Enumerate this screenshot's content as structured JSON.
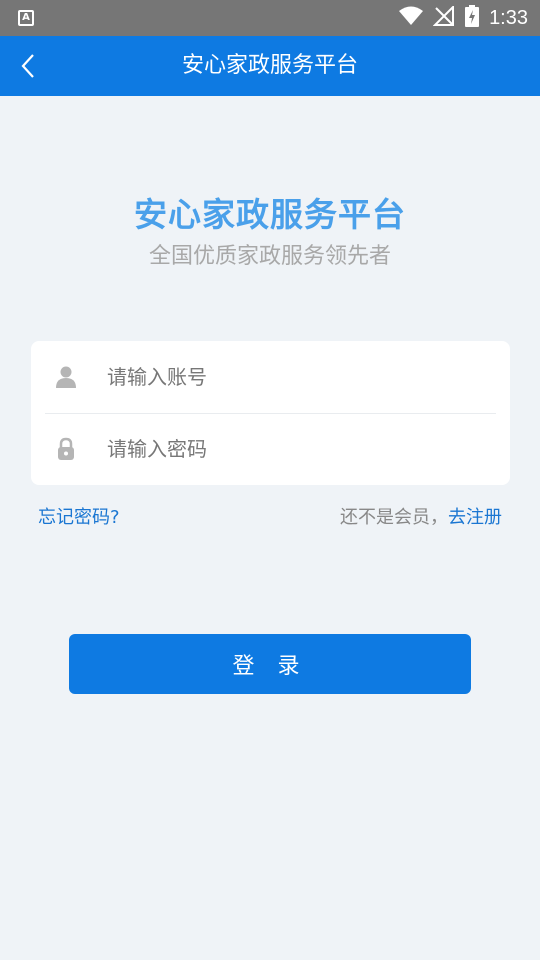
{
  "status_bar": {
    "app_icon_letter": "A",
    "time": "1:33",
    "icons": [
      "wifi-icon",
      "signal-off-icon",
      "battery-charging-icon"
    ]
  },
  "app_bar": {
    "title": "安心家政服务平台",
    "back_icon": "chevron-left-icon"
  },
  "brand": {
    "title": "安心家政服务平台",
    "subtitle": "全国优质家政服务领先者"
  },
  "form": {
    "account_placeholder": "请输入账号",
    "account_value": "",
    "account_icon": "user-icon",
    "password_placeholder": "请输入密码",
    "password_value": "",
    "password_icon": "lock-icon"
  },
  "links": {
    "forgot": "忘记密码?",
    "not_member": "还不是会员，",
    "register": "去注册"
  },
  "login_button": "登 录",
  "colors": {
    "primary": "#0e7ae2",
    "brand_title": "#4aa0ea",
    "link": "#1a76d2",
    "background": "#eff3f7",
    "status_bar": "#767676"
  }
}
